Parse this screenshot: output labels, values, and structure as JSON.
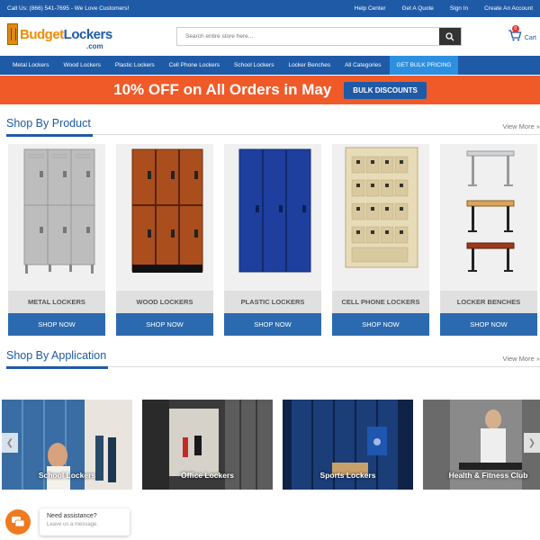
{
  "topbar": {
    "phone": "Call Us: (866) 541-7695 - We Love Customers!",
    "links": [
      "Help Center",
      "Get A Quote",
      "Sign In",
      "Create An Account"
    ]
  },
  "header": {
    "logo_part1": "Budget",
    "logo_part2": "Lockers",
    "logo_sub": ".com",
    "search_placeholder": "Search entire store here...",
    "cart_label": "Cart",
    "cart_count": "0"
  },
  "nav": {
    "items": [
      "Metal Lockers",
      "Wood Lockers",
      "Plastic Lockers",
      "Cell Phone Lockers",
      "School Lockers",
      "Locker Benches",
      "All Categories"
    ],
    "bulk": "GET BULK PRICING"
  },
  "promo": {
    "text": "10% OFF on All Orders in May",
    "button": "BULK DISCOUNTS"
  },
  "shop_by_product": {
    "title": "Shop By Product",
    "view_more": "View More »",
    "shop_now": "SHOP NOW",
    "items": [
      "METAL LOCKERS",
      "WOOD LOCKERS",
      "PLASTIC LOCKERS",
      "CELL PHONE LOCKERS",
      "LOCKER BENCHES"
    ]
  },
  "shop_by_application": {
    "title": "Shop By Application",
    "view_more": "View More »",
    "items": [
      "School Lockers",
      "Office Lockers",
      "Sports Lockers",
      "Health & Fitness Club"
    ]
  },
  "chat": {
    "title": "Need assistance?",
    "subtitle": "Leave us a message."
  },
  "colors": {
    "brand_blue": "#1f5aa6",
    "promo_orange": "#f05a28",
    "logo_orange": "#f08b00"
  }
}
